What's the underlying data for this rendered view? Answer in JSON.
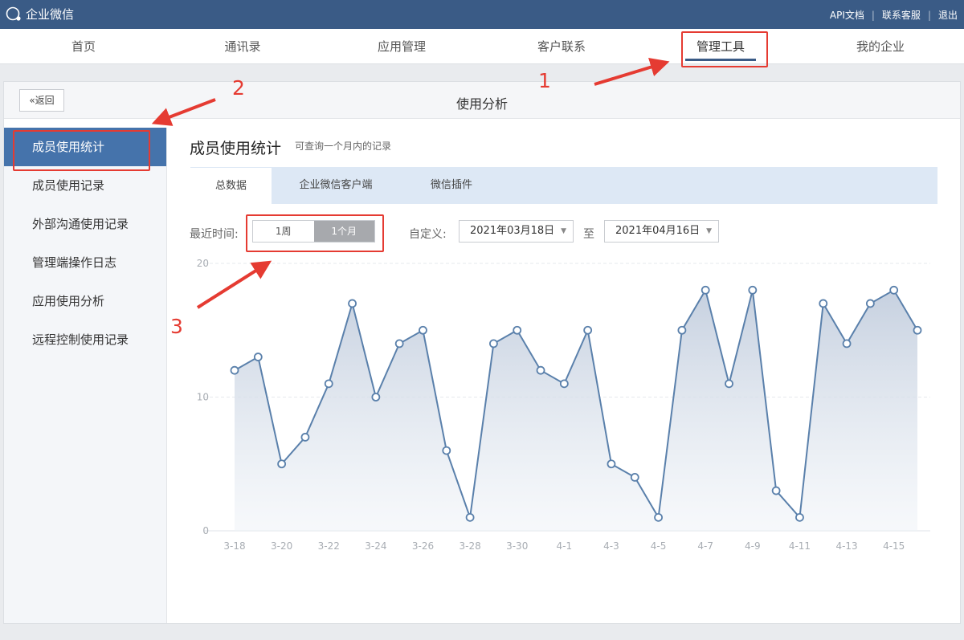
{
  "header": {
    "logo_text": "企业微信",
    "links": [
      "API文档",
      "联系客服",
      "退出"
    ]
  },
  "nav": {
    "items": [
      "首页",
      "通讯录",
      "应用管理",
      "客户联系",
      "管理工具",
      "我的企业"
    ],
    "active": "管理工具"
  },
  "panel": {
    "back_label": "返回",
    "title": "使用分析"
  },
  "sidebar": {
    "items": [
      "成员使用统计",
      "成员使用记录",
      "外部沟通使用记录",
      "管理端操作日志",
      "应用使用分析",
      "远程控制使用记录"
    ],
    "active": "成员使用统计"
  },
  "content": {
    "title": "成员使用统计",
    "subtitle": "可查询一个月内的记录",
    "tabs": [
      "总数据",
      "企业微信客户端",
      "微信插件"
    ],
    "active_tab": "总数据"
  },
  "filter": {
    "recent_label": "最近时间:",
    "options": [
      "1周",
      "1个月"
    ],
    "selected": "1个月",
    "custom_label": "自定义:",
    "start_date": "2021年03月18日",
    "to_label": "至",
    "end_date": "2021年04月16日"
  },
  "annotations": [
    "1",
    "2",
    "3"
  ],
  "colors": {
    "header": "#3a5b86",
    "accent": "#4573ab",
    "line": "#5a80ab",
    "annotation": "#e53b32"
  },
  "chart_data": {
    "type": "area",
    "x": [
      "3-18",
      "3-19",
      "3-20",
      "3-21",
      "3-22",
      "3-23",
      "3-24",
      "3-25",
      "3-26",
      "3-27",
      "3-28",
      "3-29",
      "3-30",
      "3-31",
      "4-1",
      "4-2",
      "4-3",
      "4-4",
      "4-5",
      "4-6",
      "4-7",
      "4-8",
      "4-9",
      "4-10",
      "4-11",
      "4-12",
      "4-13",
      "4-14",
      "4-15",
      "4-16"
    ],
    "x_tick_labels": [
      "3-18",
      "3-20",
      "3-22",
      "3-24",
      "3-26",
      "3-28",
      "3-30",
      "4-1",
      "4-3",
      "4-5",
      "4-7",
      "4-9",
      "4-11",
      "4-13",
      "4-15"
    ],
    "values": [
      12,
      13,
      5,
      7,
      11,
      17,
      10,
      14,
      15,
      6,
      1,
      14,
      15,
      12,
      11,
      15,
      5,
      4,
      1,
      15,
      18,
      11,
      18,
      3,
      1,
      17,
      14,
      17,
      18,
      15
    ],
    "y_ticks": [
      0,
      10,
      20
    ],
    "ylim": [
      0,
      20
    ],
    "grid": true
  }
}
